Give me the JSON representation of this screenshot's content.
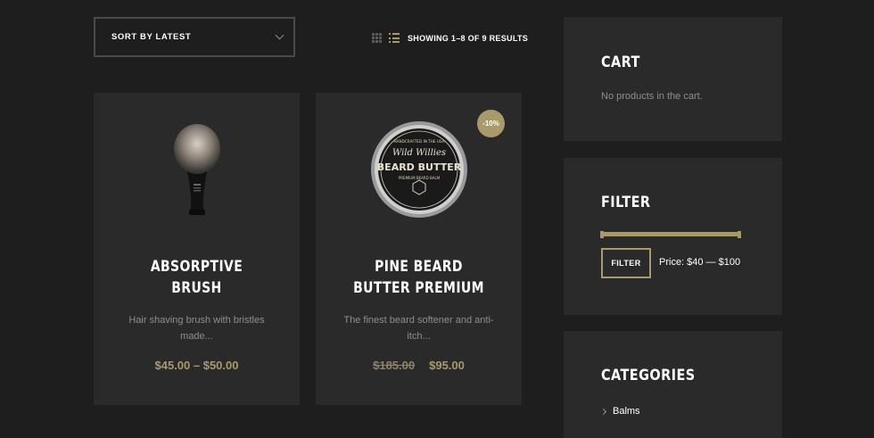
{
  "toolbar": {
    "sort_label": "SORT BY LATEST",
    "results_text": "SHOWING 1–8 OF 9 RESULTS"
  },
  "products": [
    {
      "title": "ABSORPTIVE\nBRUSH",
      "description": "Hair shaving brush with bristles made...",
      "price": "$45.00 – $50.00"
    },
    {
      "title": "PINE BEARD\nBUTTER PREMIUM",
      "description": "The finest beard softener and anti-itch...",
      "old_price": "$185.00",
      "price": "$95.00",
      "badge": "-10%",
      "image_text": {
        "top": "HANDCRAFTED IN THE USA",
        "brand": "Wild Willies",
        "name": "BEARD BUTTER",
        "sub": "PREMIUM BEARD BALM"
      }
    }
  ],
  "widgets": {
    "cart": {
      "title": "CART",
      "empty_text": "No products in the cart."
    },
    "filter": {
      "title": "FILTER",
      "button_label": "FILTER",
      "price_text": "Price: $40 — $100"
    },
    "categories": {
      "title": "CATEGORIES",
      "items": [
        "Balms"
      ]
    }
  },
  "colors": {
    "accent": "#a89a6a",
    "card_bg": "#2a2a2a",
    "page_bg": "#1e1e1e"
  }
}
